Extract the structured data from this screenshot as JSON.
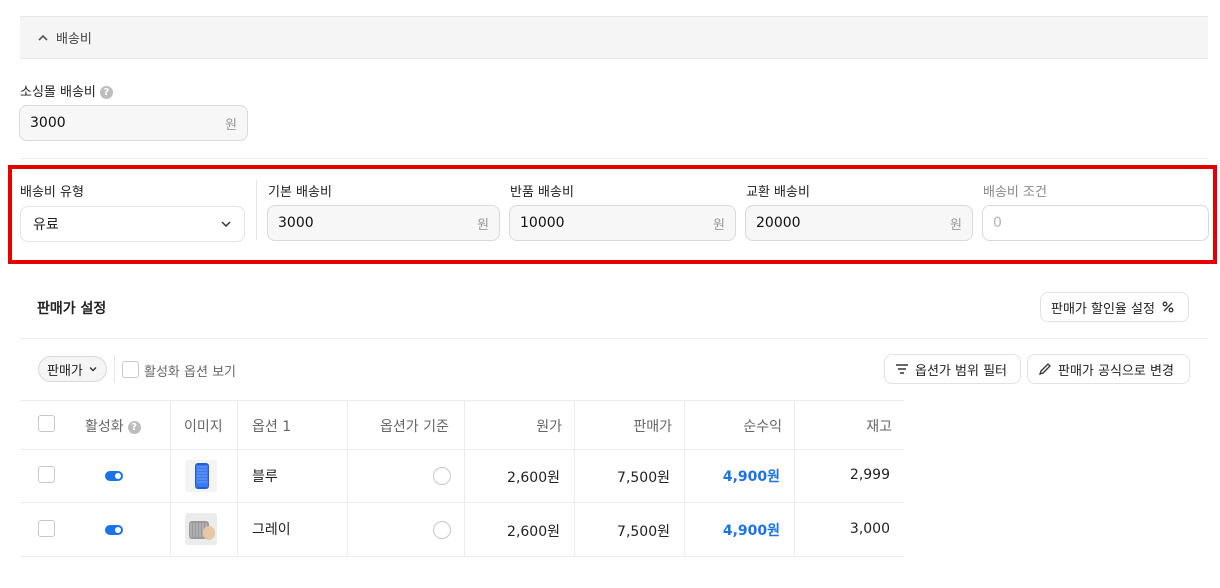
{
  "shipping_section": {
    "title": "배송비"
  },
  "island_shipping": {
    "label": "소싱몰 배송비",
    "value": "3000",
    "unit": "원"
  },
  "shipping_fields": {
    "type_label": "배송비 유형",
    "type_value": "유료",
    "base_label": "기본 배송비",
    "base_value": "3000",
    "return_label": "반품 배송비",
    "return_value": "10000",
    "exchange_label": "교환 배송비",
    "exchange_value": "20000",
    "condition_label": "배송비 조건",
    "condition_placeholder": "0",
    "unit": "원"
  },
  "price_settings": {
    "title": "판매가 설정",
    "discount_button": "판매가 할인율 설정",
    "filter_pill": "판매가",
    "active_only_label": "활성화 옵션 보기",
    "range_filter_button": "옵션가 범위 필터",
    "formula_button": "판매가 공식으로 변경"
  },
  "table": {
    "headers": {
      "active": "활성화",
      "image": "이미지",
      "option1": "옵션 1",
      "option_base": "옵션가 기준",
      "cost": "원가",
      "price": "판매가",
      "profit": "순수익",
      "stock": "재고"
    },
    "rows": [
      {
        "option1": "블루",
        "cost": "2,600원",
        "price": "7,500원",
        "profit": "4,900원",
        "stock": "2,999"
      },
      {
        "option1": "그레이",
        "cost": "2,600원",
        "price": "7,500원",
        "profit": "4,900원",
        "stock": "3,000"
      }
    ]
  },
  "colors": {
    "highlight_border": "#e60000",
    "accent": "#1a73e8"
  }
}
